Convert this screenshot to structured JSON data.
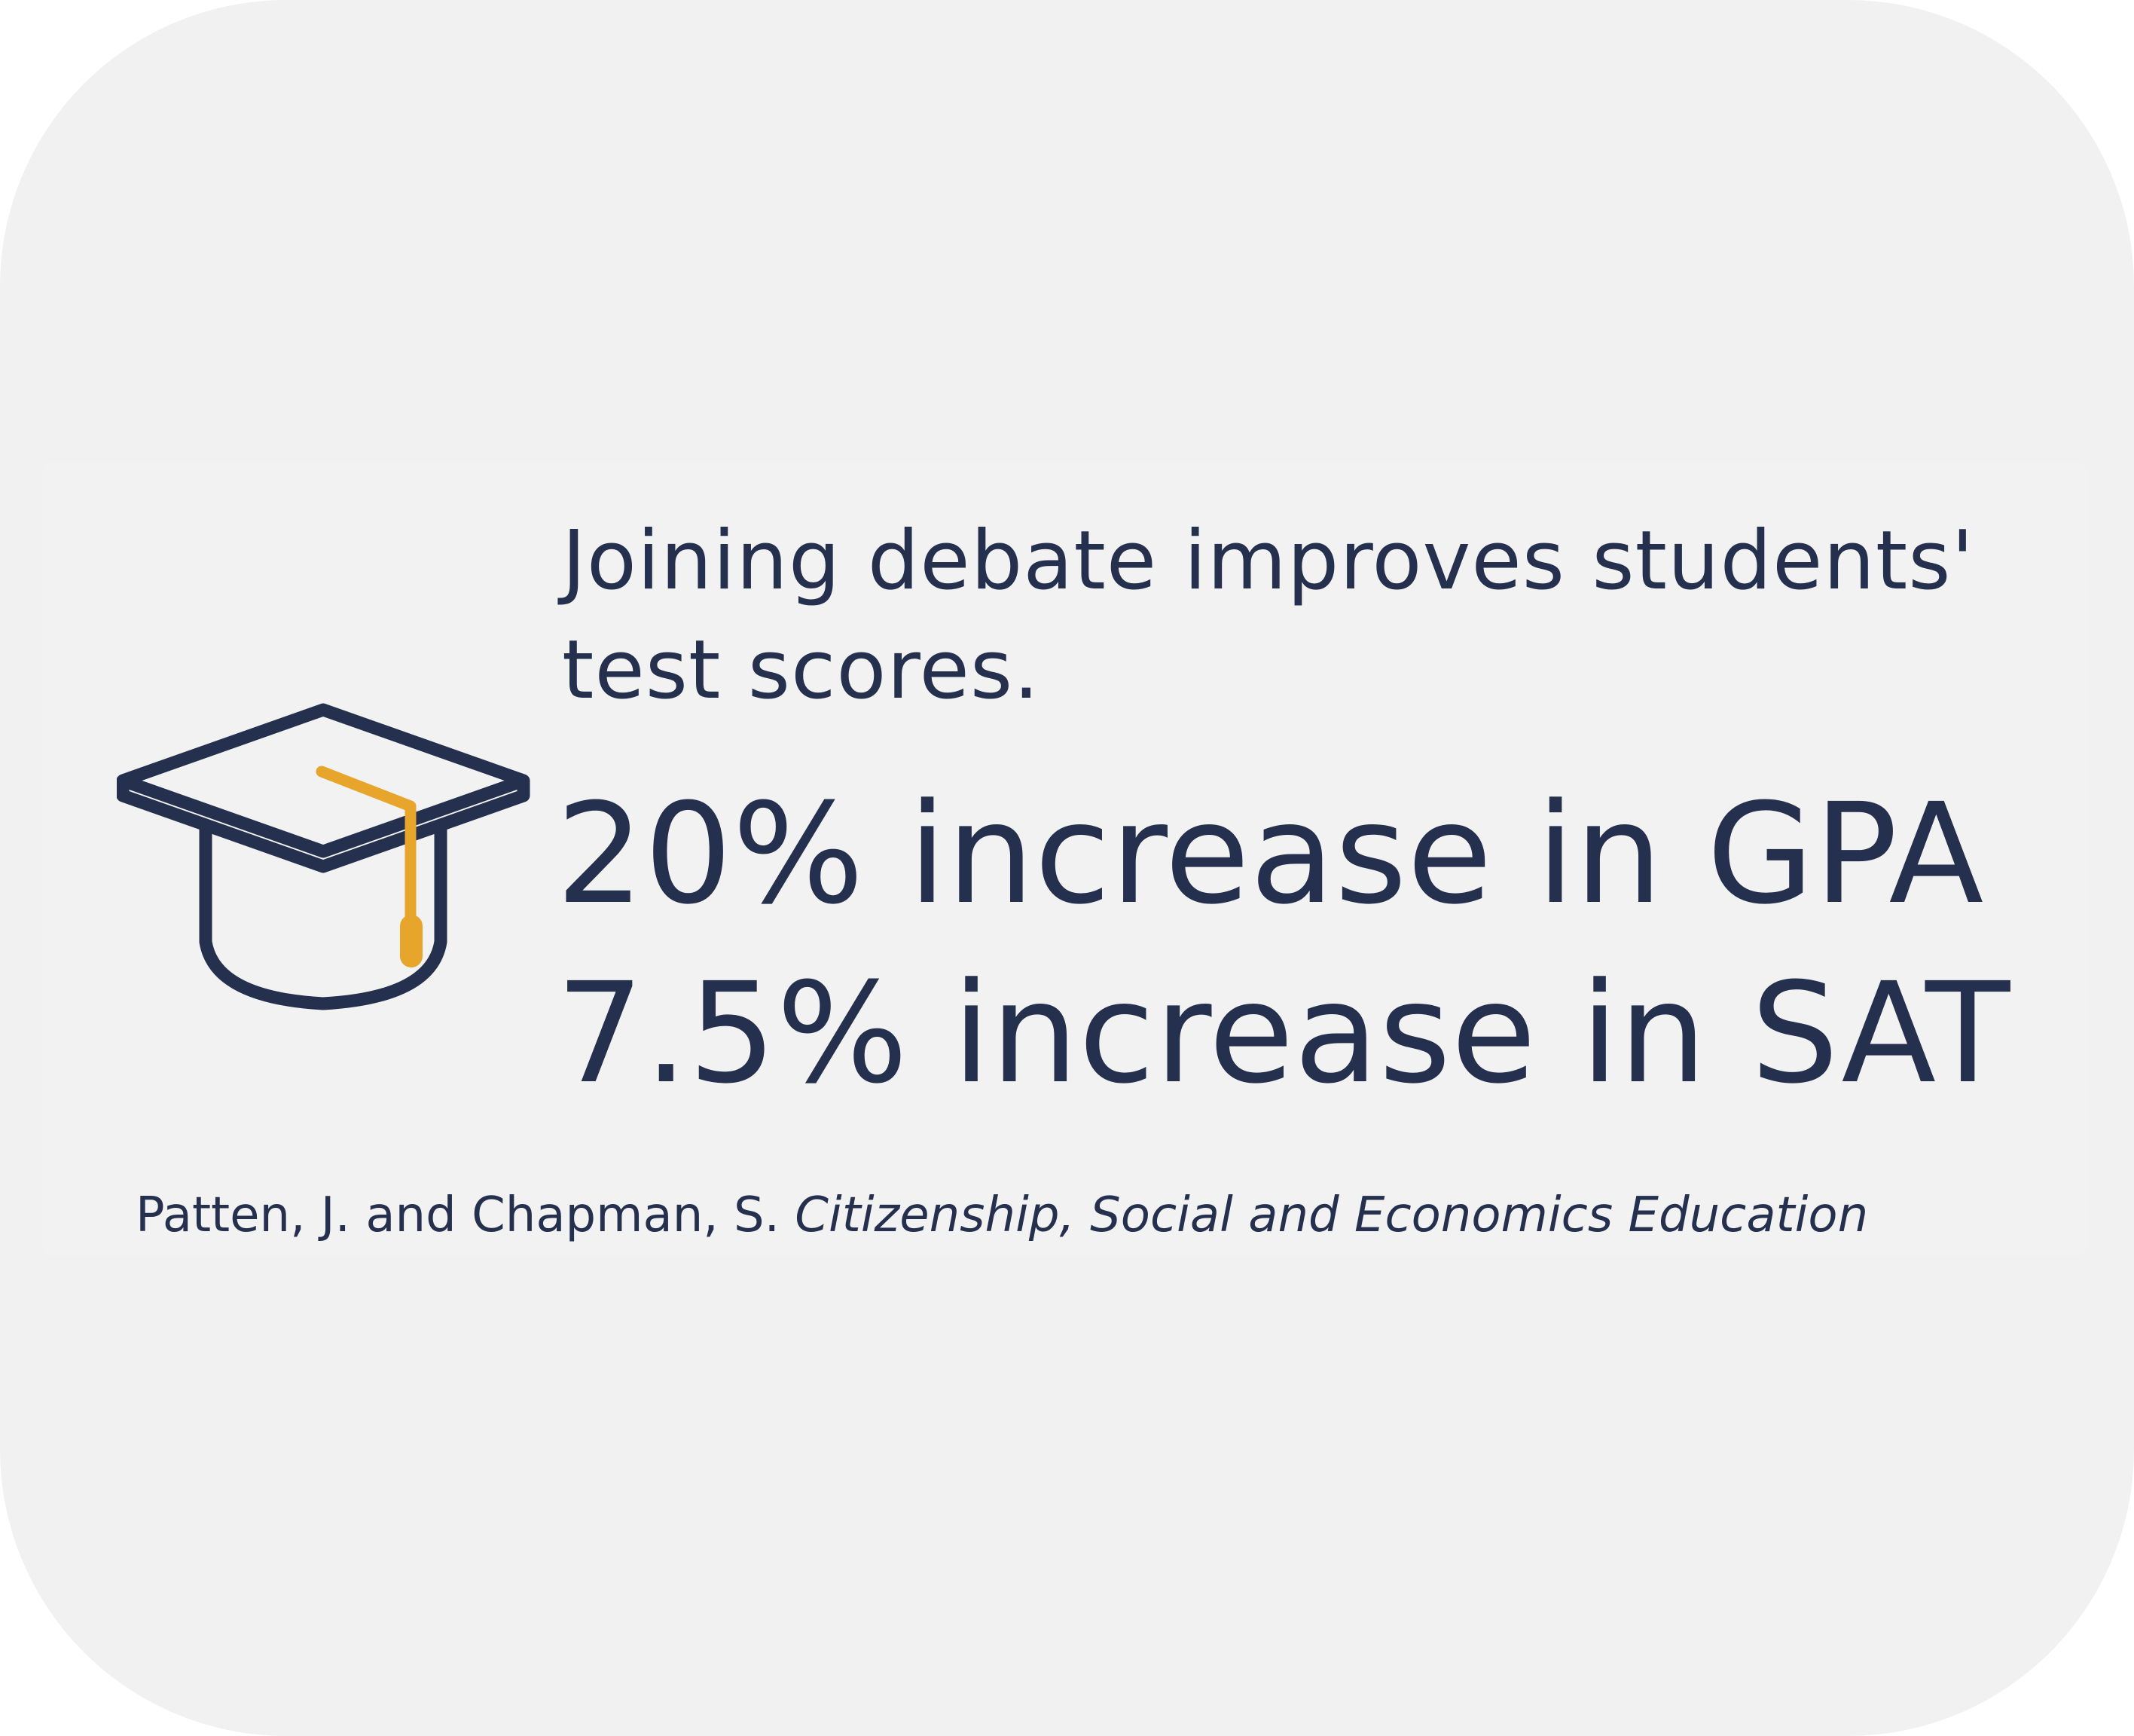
{
  "card": {
    "headline": "Joining debate improves students' test scores.",
    "stats": [
      {
        "text": "20% increase in GPA"
      },
      {
        "text": "7.5% increase in SAT"
      }
    ],
    "citation": {
      "authors": "Patten, J. and Chapman, S.",
      "source": "Citizenship, Social and Economics Education"
    },
    "icon": "graduation-cap-icon"
  },
  "colors": {
    "background": "#f1f1f1",
    "text": "#25304f",
    "icon_outline": "#25304f",
    "tassel": "#e8a52c"
  }
}
